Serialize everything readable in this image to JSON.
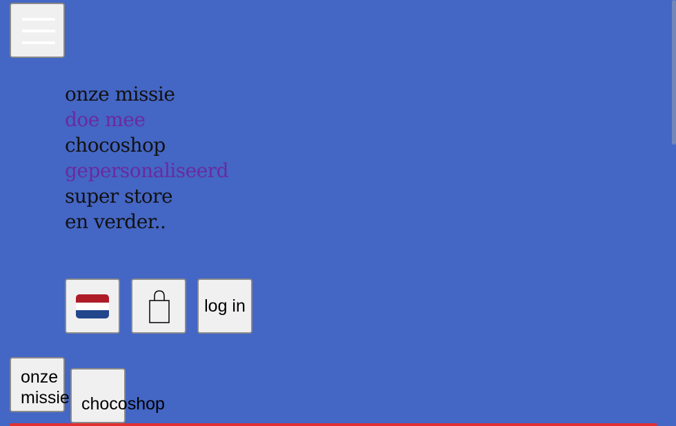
{
  "menu_button": {
    "icon": "hamburger-icon"
  },
  "nav": {
    "items": [
      {
        "label": "onze missie",
        "visited": false
      },
      {
        "label": "doe mee",
        "visited": true
      },
      {
        "label": "chocoshop",
        "visited": false
      },
      {
        "label": "gepersonaliseerd",
        "visited": true
      },
      {
        "label": "super store",
        "visited": false
      },
      {
        "label": "en verder..",
        "visited": false
      }
    ]
  },
  "actions": {
    "language_flag": "netherlands-flag-icon",
    "flag_colors": [
      "#ae1c28",
      "#ffffff",
      "#21468b"
    ],
    "bag_icon": "shopping-bag-icon",
    "login_label": "log in"
  },
  "bottom_buttons": {
    "first_label": "onze missie",
    "second_label": "chocoshop"
  },
  "colors": {
    "background": "#4466c4",
    "link": "#111111",
    "visited_link": "#6a2aa0",
    "accent_line": "#e03030"
  }
}
